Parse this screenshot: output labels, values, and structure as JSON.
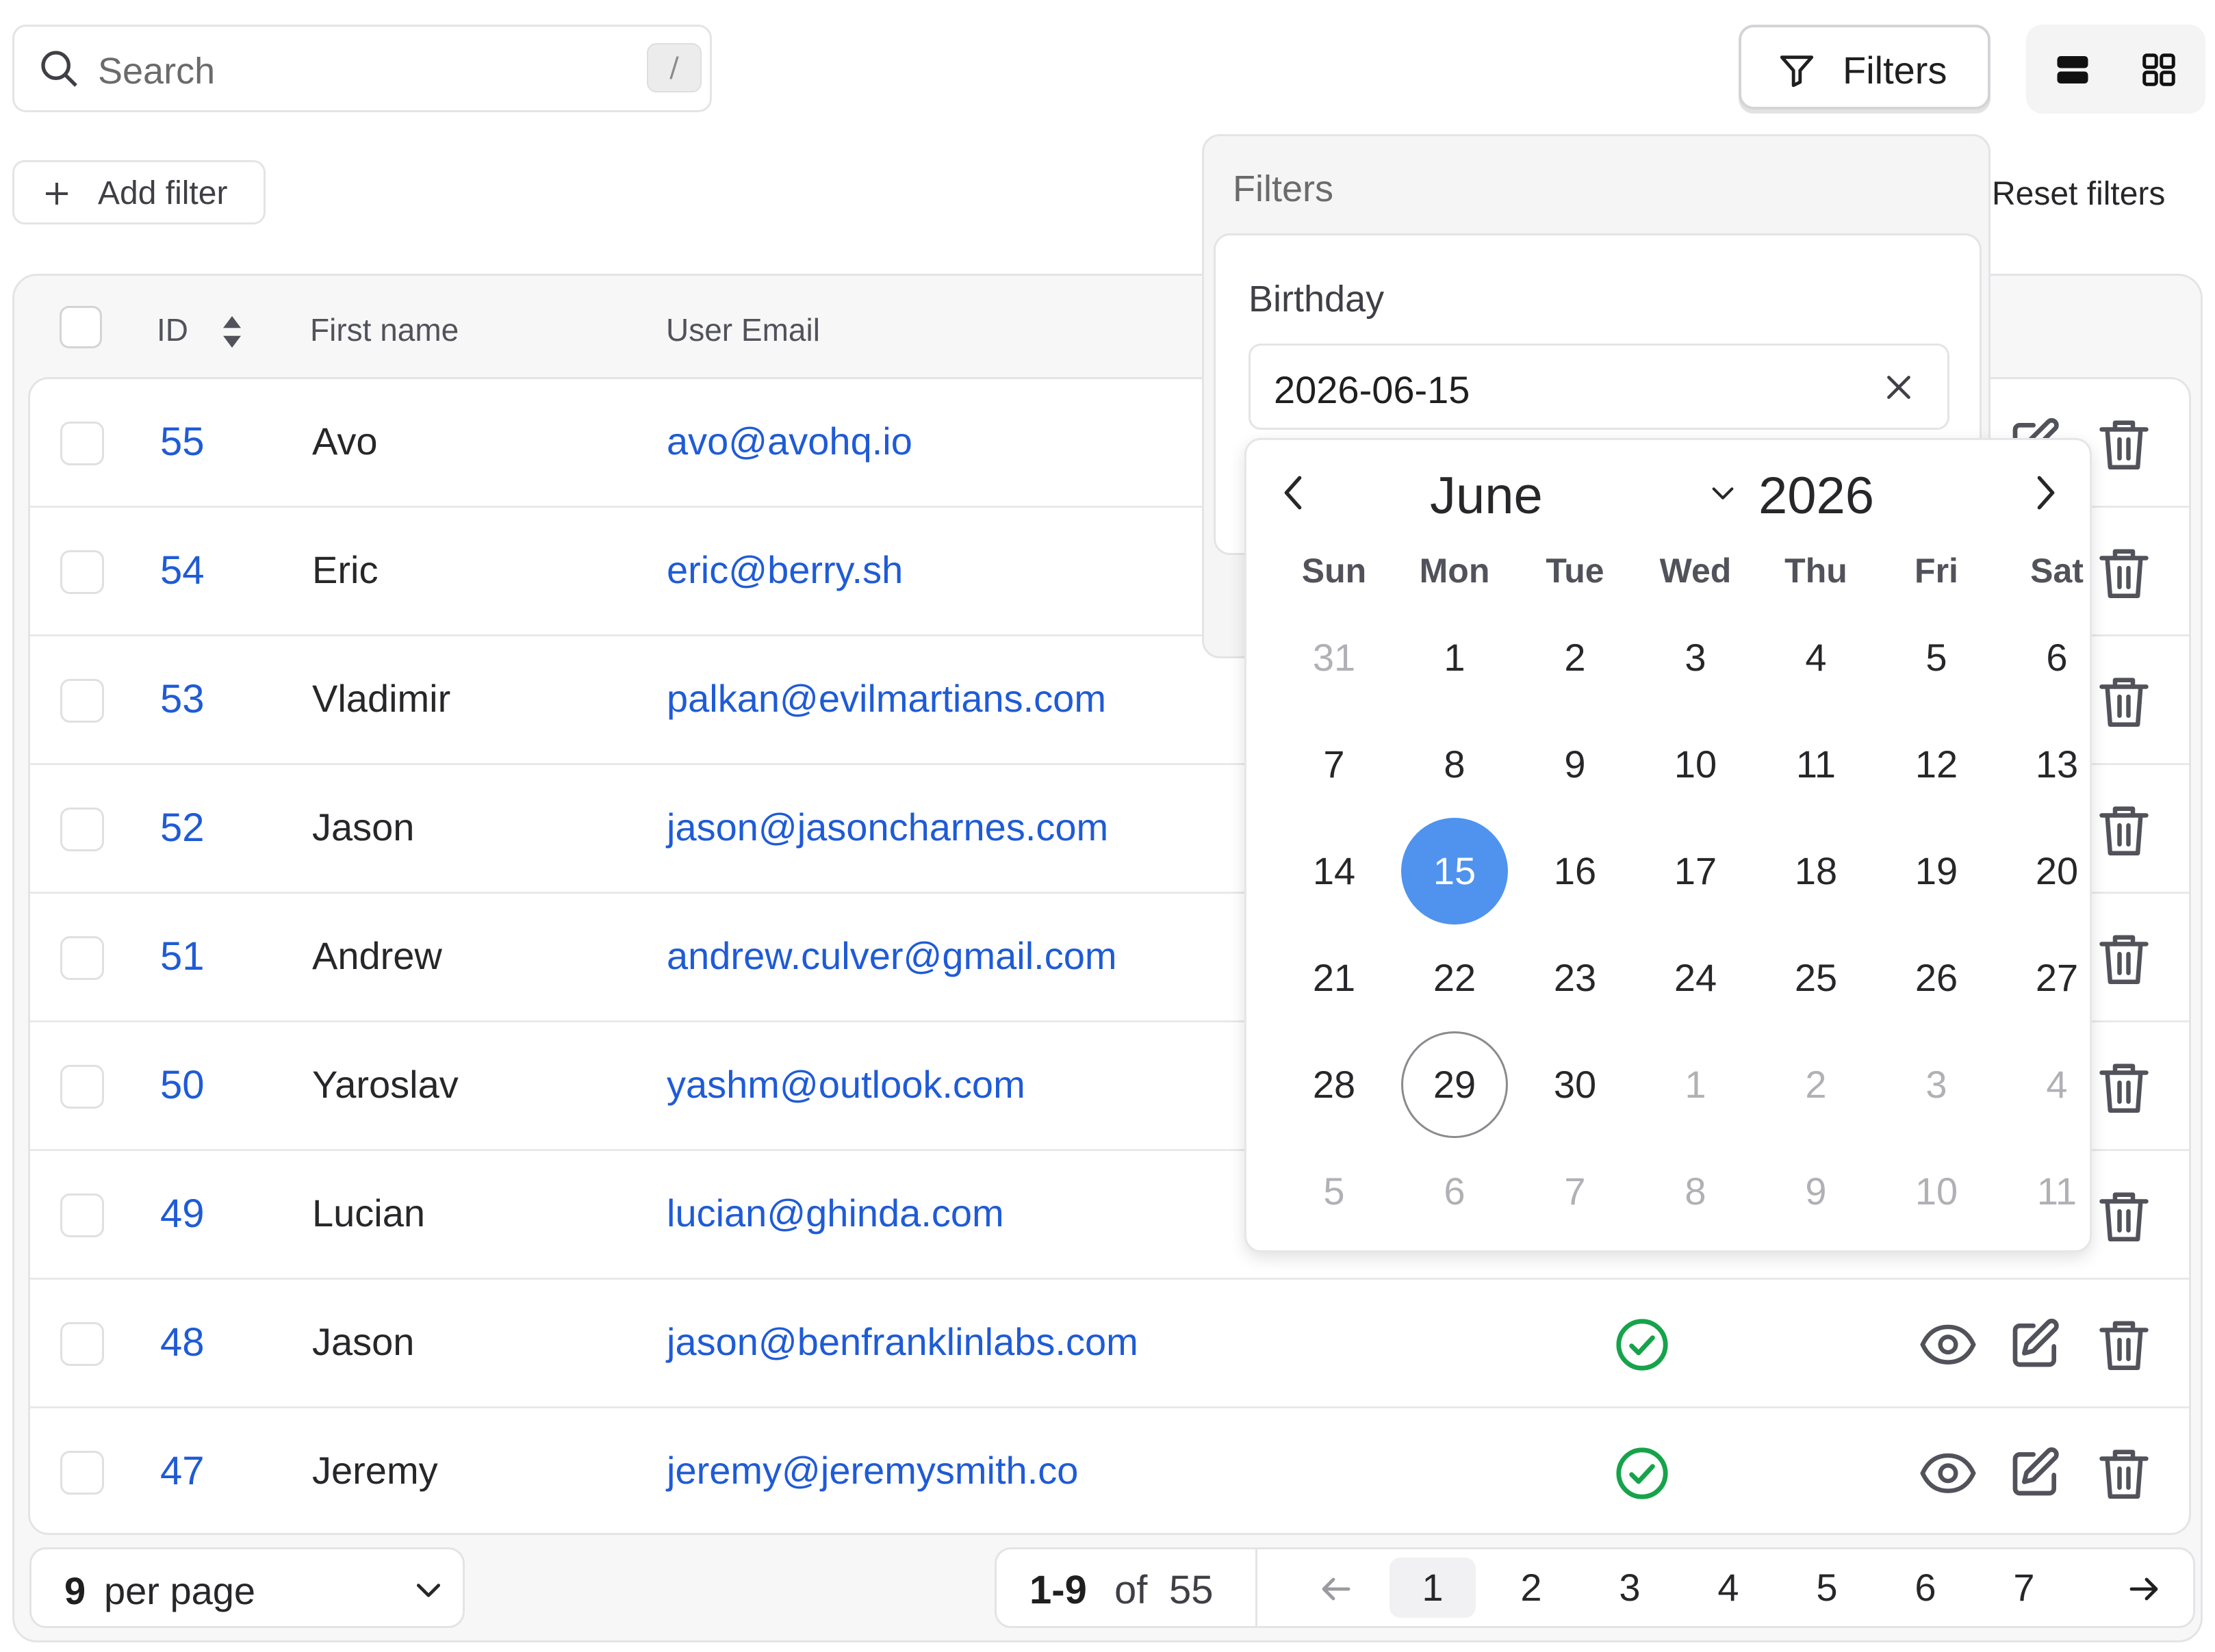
{
  "search": {
    "placeholder": "Search",
    "shortcut": "/"
  },
  "toolbar": {
    "filters_label": "Filters",
    "add_filter_label": "Add filter",
    "reset_label": "Reset filters"
  },
  "table": {
    "headers": {
      "id": "ID",
      "first_name": "First name",
      "email": "User Email"
    },
    "rows": [
      {
        "id": "55",
        "first_name": "Avo",
        "email": "avo@avohq.io",
        "active": false
      },
      {
        "id": "54",
        "first_name": "Eric",
        "email": "eric@berry.sh",
        "active": false
      },
      {
        "id": "53",
        "first_name": "Vladimir",
        "email": "palkan@evilmartians.com",
        "active": false
      },
      {
        "id": "52",
        "first_name": "Jason",
        "email": "jason@jasoncharnes.com",
        "active": false
      },
      {
        "id": "51",
        "first_name": "Andrew",
        "email": "andrew.culver@gmail.com",
        "active": false
      },
      {
        "id": "50",
        "first_name": "Yaroslav",
        "email": "yashm@outlook.com",
        "active": false
      },
      {
        "id": "49",
        "first_name": "Lucian",
        "email": "lucian@ghinda.com",
        "active": false
      },
      {
        "id": "48",
        "first_name": "Jason",
        "email": "jason@benfranklinlabs.com",
        "active": true
      },
      {
        "id": "47",
        "first_name": "Jeremy",
        "email": "jeremy@jeremysmith.co",
        "active": true
      }
    ]
  },
  "pagination": {
    "per_page_value": "9",
    "per_page_text": "per page",
    "range": "1-9",
    "of": "of",
    "total": "55",
    "pages": [
      "1",
      "2",
      "3",
      "4",
      "5",
      "6",
      "7"
    ],
    "current_page": "1"
  },
  "filters_panel": {
    "title": "Filters",
    "field_label": "Birthday",
    "field_value": "2026-06-15"
  },
  "calendar": {
    "month": "June",
    "year": "2026",
    "weekdays": [
      "Sun",
      "Mon",
      "Tue",
      "Wed",
      "Thu",
      "Fri",
      "Sat"
    ],
    "weeks": [
      [
        "31",
        "1",
        "2",
        "3",
        "4",
        "5",
        "6"
      ],
      [
        "7",
        "8",
        "9",
        "10",
        "11",
        "12",
        "13"
      ],
      [
        "14",
        "15",
        "16",
        "17",
        "18",
        "19",
        "20"
      ],
      [
        "21",
        "22",
        "23",
        "24",
        "25",
        "26",
        "27"
      ],
      [
        "28",
        "29",
        "30",
        "1",
        "2",
        "3",
        "4"
      ],
      [
        "5",
        "6",
        "7",
        "8",
        "9",
        "10",
        "11"
      ]
    ],
    "selected": "15",
    "today": "29"
  },
  "colors": {
    "link": "#1f5bd6",
    "selected_day": "#4f93ee",
    "success": "#16a34a"
  },
  "icons": [
    "search-icon",
    "funnel-icon",
    "list-view-icon",
    "grid-view-icon",
    "plus-icon",
    "sort-icon",
    "check-circle-icon",
    "eye-icon",
    "edit-icon",
    "trash-icon",
    "chevron-down-icon",
    "arrow-left-icon",
    "arrow-right-icon",
    "chevron-left-icon",
    "chevron-right-icon",
    "close-icon"
  ]
}
